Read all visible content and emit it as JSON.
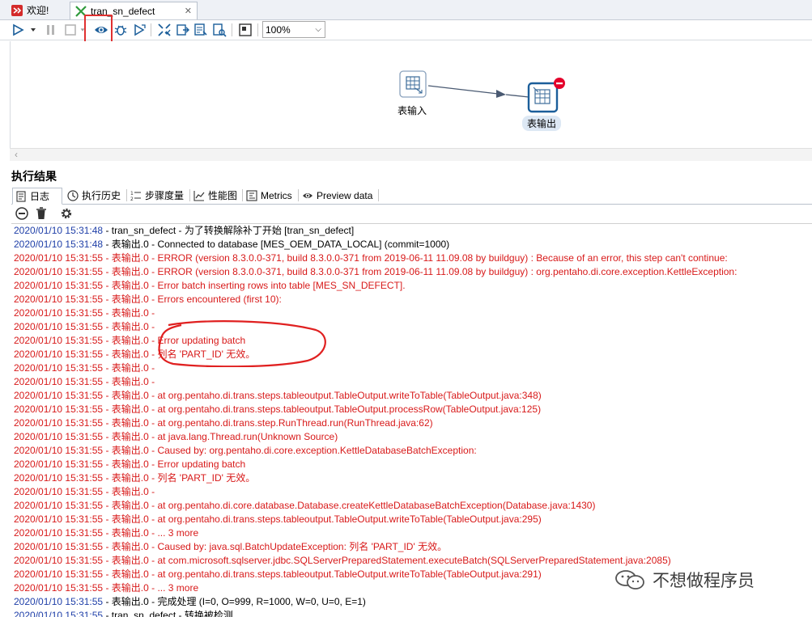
{
  "tabs": [
    {
      "label": "欢迎!"
    },
    {
      "label": "tran_sn_defect"
    }
  ],
  "toolbar": {
    "zoom_value": "100%"
  },
  "canvas": {
    "steps": [
      {
        "label": "表输入"
      },
      {
        "label": "表输出"
      }
    ]
  },
  "results": {
    "title": "执行结果",
    "tabs": [
      {
        "label": "日志"
      },
      {
        "label": "执行历史"
      },
      {
        "label": "步骤度量"
      },
      {
        "label": "性能图"
      },
      {
        "label": "Metrics"
      },
      {
        "label": "Preview data"
      }
    ],
    "log": [
      {
        "ts": "2020/01/10 15:31:48",
        "msg": " - tran_sn_defect - 为了转换解除补丁开始  [tran_sn_defect]",
        "level": "info"
      },
      {
        "ts": "2020/01/10 15:31:48",
        "msg": " - 表输出.0 - Connected to database [MES_OEM_DATA_LOCAL] (commit=1000)",
        "level": "info"
      },
      {
        "ts": "2020/01/10 15:31:55",
        "msg": " - 表输出.0 - ERROR (version 8.3.0.0-371, build 8.3.0.0-371 from 2019-06-11 11.09.08 by buildguy) : Because of an error, this step can't continue:",
        "level": "error"
      },
      {
        "ts": "2020/01/10 15:31:55",
        "msg": " - 表输出.0 - ERROR (version 8.3.0.0-371, build 8.3.0.0-371 from 2019-06-11 11.09.08 by buildguy) : org.pentaho.di.core.exception.KettleException:",
        "level": "error"
      },
      {
        "ts": "2020/01/10 15:31:55",
        "msg": " - 表输出.0 - Error batch inserting rows into table [MES_SN_DEFECT].",
        "level": "error"
      },
      {
        "ts": "2020/01/10 15:31:55",
        "msg": " - 表输出.0 - Errors encountered (first 10):",
        "level": "error"
      },
      {
        "ts": "2020/01/10 15:31:55",
        "msg": " - 表输出.0 -",
        "level": "error"
      },
      {
        "ts": "2020/01/10 15:31:55",
        "msg": " - 表输出.0 -",
        "level": "error"
      },
      {
        "ts": "2020/01/10 15:31:55",
        "msg": " - 表输出.0 - Error updating batch",
        "level": "error"
      },
      {
        "ts": "2020/01/10 15:31:55",
        "msg": " - 表输出.0 - 列名 'PART_ID' 无效。",
        "level": "error"
      },
      {
        "ts": "2020/01/10 15:31:55",
        "msg": " - 表输出.0 -",
        "level": "error"
      },
      {
        "ts": "2020/01/10 15:31:55",
        "msg": " - 表输出.0 -",
        "level": "error"
      },
      {
        "ts": "2020/01/10 15:31:55",
        "msg": " - 表输出.0 -  at org.pentaho.di.trans.steps.tableoutput.TableOutput.writeToTable(TableOutput.java:348)",
        "level": "error"
      },
      {
        "ts": "2020/01/10 15:31:55",
        "msg": " - 表输出.0 -  at org.pentaho.di.trans.steps.tableoutput.TableOutput.processRow(TableOutput.java:125)",
        "level": "error"
      },
      {
        "ts": "2020/01/10 15:31:55",
        "msg": " - 表输出.0 -  at org.pentaho.di.trans.step.RunThread.run(RunThread.java:62)",
        "level": "error"
      },
      {
        "ts": "2020/01/10 15:31:55",
        "msg": " - 表输出.0 -  at java.lang.Thread.run(Unknown Source)",
        "level": "error"
      },
      {
        "ts": "2020/01/10 15:31:55",
        "msg": " - 表输出.0 - Caused by: org.pentaho.di.core.exception.KettleDatabaseBatchException:",
        "level": "error"
      },
      {
        "ts": "2020/01/10 15:31:55",
        "msg": " - 表输出.0 - Error updating batch",
        "level": "error"
      },
      {
        "ts": "2020/01/10 15:31:55",
        "msg": " - 表输出.0 - 列名 'PART_ID' 无效。",
        "level": "error"
      },
      {
        "ts": "2020/01/10 15:31:55",
        "msg": " - 表输出.0 -",
        "level": "error"
      },
      {
        "ts": "2020/01/10 15:31:55",
        "msg": " - 表输出.0 -  at org.pentaho.di.core.database.Database.createKettleDatabaseBatchException(Database.java:1430)",
        "level": "error"
      },
      {
        "ts": "2020/01/10 15:31:55",
        "msg": " - 表输出.0 -  at org.pentaho.di.trans.steps.tableoutput.TableOutput.writeToTable(TableOutput.java:295)",
        "level": "error"
      },
      {
        "ts": "2020/01/10 15:31:55",
        "msg": " - 表输出.0 -  ... 3 more",
        "level": "error"
      },
      {
        "ts": "2020/01/10 15:31:55",
        "msg": " - 表输出.0 - Caused by: java.sql.BatchUpdateException: 列名 'PART_ID' 无效。",
        "level": "error"
      },
      {
        "ts": "2020/01/10 15:31:55",
        "msg": " - 表输出.0 -  at com.microsoft.sqlserver.jdbc.SQLServerPreparedStatement.executeBatch(SQLServerPreparedStatement.java:2085)",
        "level": "error"
      },
      {
        "ts": "2020/01/10 15:31:55",
        "msg": " - 表输出.0 -  at org.pentaho.di.trans.steps.tableoutput.TableOutput.writeToTable(TableOutput.java:291)",
        "level": "error"
      },
      {
        "ts": "2020/01/10 15:31:55",
        "msg": " - 表输出.0 -  ... 3 more",
        "level": "error"
      },
      {
        "ts": "2020/01/10 15:31:55",
        "msg": " - 表输出.0 - 完成处理 (I=0, O=999, R=1000, W=0, U=0, E=1)",
        "level": "info"
      },
      {
        "ts": "2020/01/10 15:31:55",
        "msg": " - tran_sn_defect - 转换被检测",
        "level": "info"
      }
    ]
  },
  "watermark": {
    "text": "不想做程序员"
  },
  "colors": {
    "error": "#d81a1a",
    "timestamp": "#1f3fa8",
    "highlight": "#e03030",
    "accent": "#1b5e9a"
  }
}
